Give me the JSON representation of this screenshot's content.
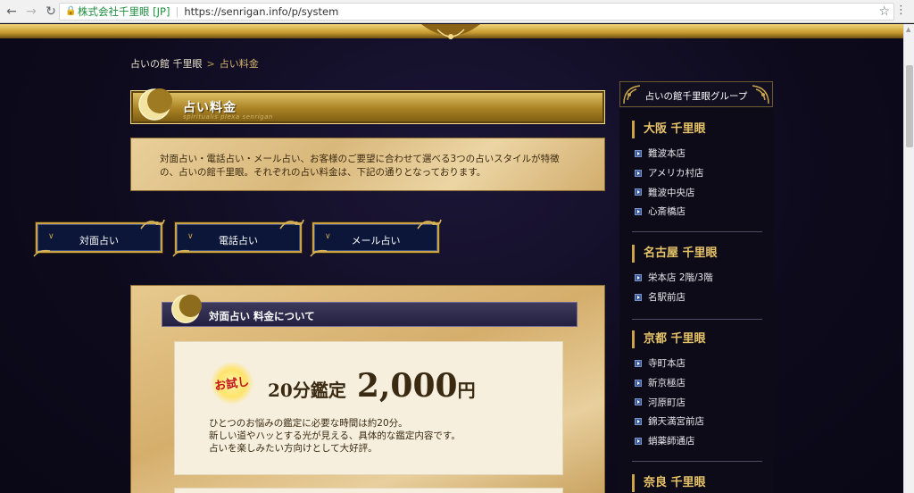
{
  "browser": {
    "secure_label": "株式会社千里眼 [JP]",
    "url": "https://senrigan.info/p/system"
  },
  "breadcrumb": {
    "home": "占いの館 千里眼",
    "separator": ">",
    "current": "占い料金"
  },
  "page_title": {
    "title": "占い料金",
    "subtitle": "spiritualis plexa senrigan"
  },
  "intro": {
    "text_line1": "対面占い・電話占い・メール占い、お客様のご要望に合わせて選べる3つの占いスタイルが特徴",
    "text_line2": "の、占いの館千里眼。それぞれの占い料金は、下記の通りとなっております。"
  },
  "tabs": [
    {
      "label": "対面占い"
    },
    {
      "label": "電話占い"
    },
    {
      "label": "メール占い"
    }
  ],
  "section": {
    "title": "対面占い 料金について",
    "badge": "お試し",
    "duration": "20分鑑定",
    "price_number": "2,000",
    "price_unit": "円",
    "desc_line1": "ひとつのお悩みの鑑定に必要な時間は約20分。",
    "desc_line2": "新しい道やハッとする光が見える、具体的な鑑定内容です。",
    "desc_line3": "占いを楽しみたい方向けとして大好評。"
  },
  "sidebar": {
    "header": "占いの館千里眼グループ",
    "regions": [
      {
        "title": "大阪 千里眼",
        "items": [
          "難波本店",
          "アメリカ村店",
          "難波中央店",
          "心斎橋店"
        ]
      },
      {
        "title": "名古屋 千里眼",
        "items": [
          "栄本店 2階/3階",
          "名駅前店"
        ]
      },
      {
        "title": "京都 千里眼",
        "items": [
          "寺町本店",
          "新京極店",
          "河原町店",
          "錦天満宮前店",
          "蛸薬師通店"
        ]
      },
      {
        "title": "奈良 千里眼",
        "items": []
      }
    ]
  },
  "colors": {
    "gold": "#c9a44b",
    "navy": "#0b1638",
    "parchment": "#e7c98e",
    "background": "#0e0b1f"
  }
}
